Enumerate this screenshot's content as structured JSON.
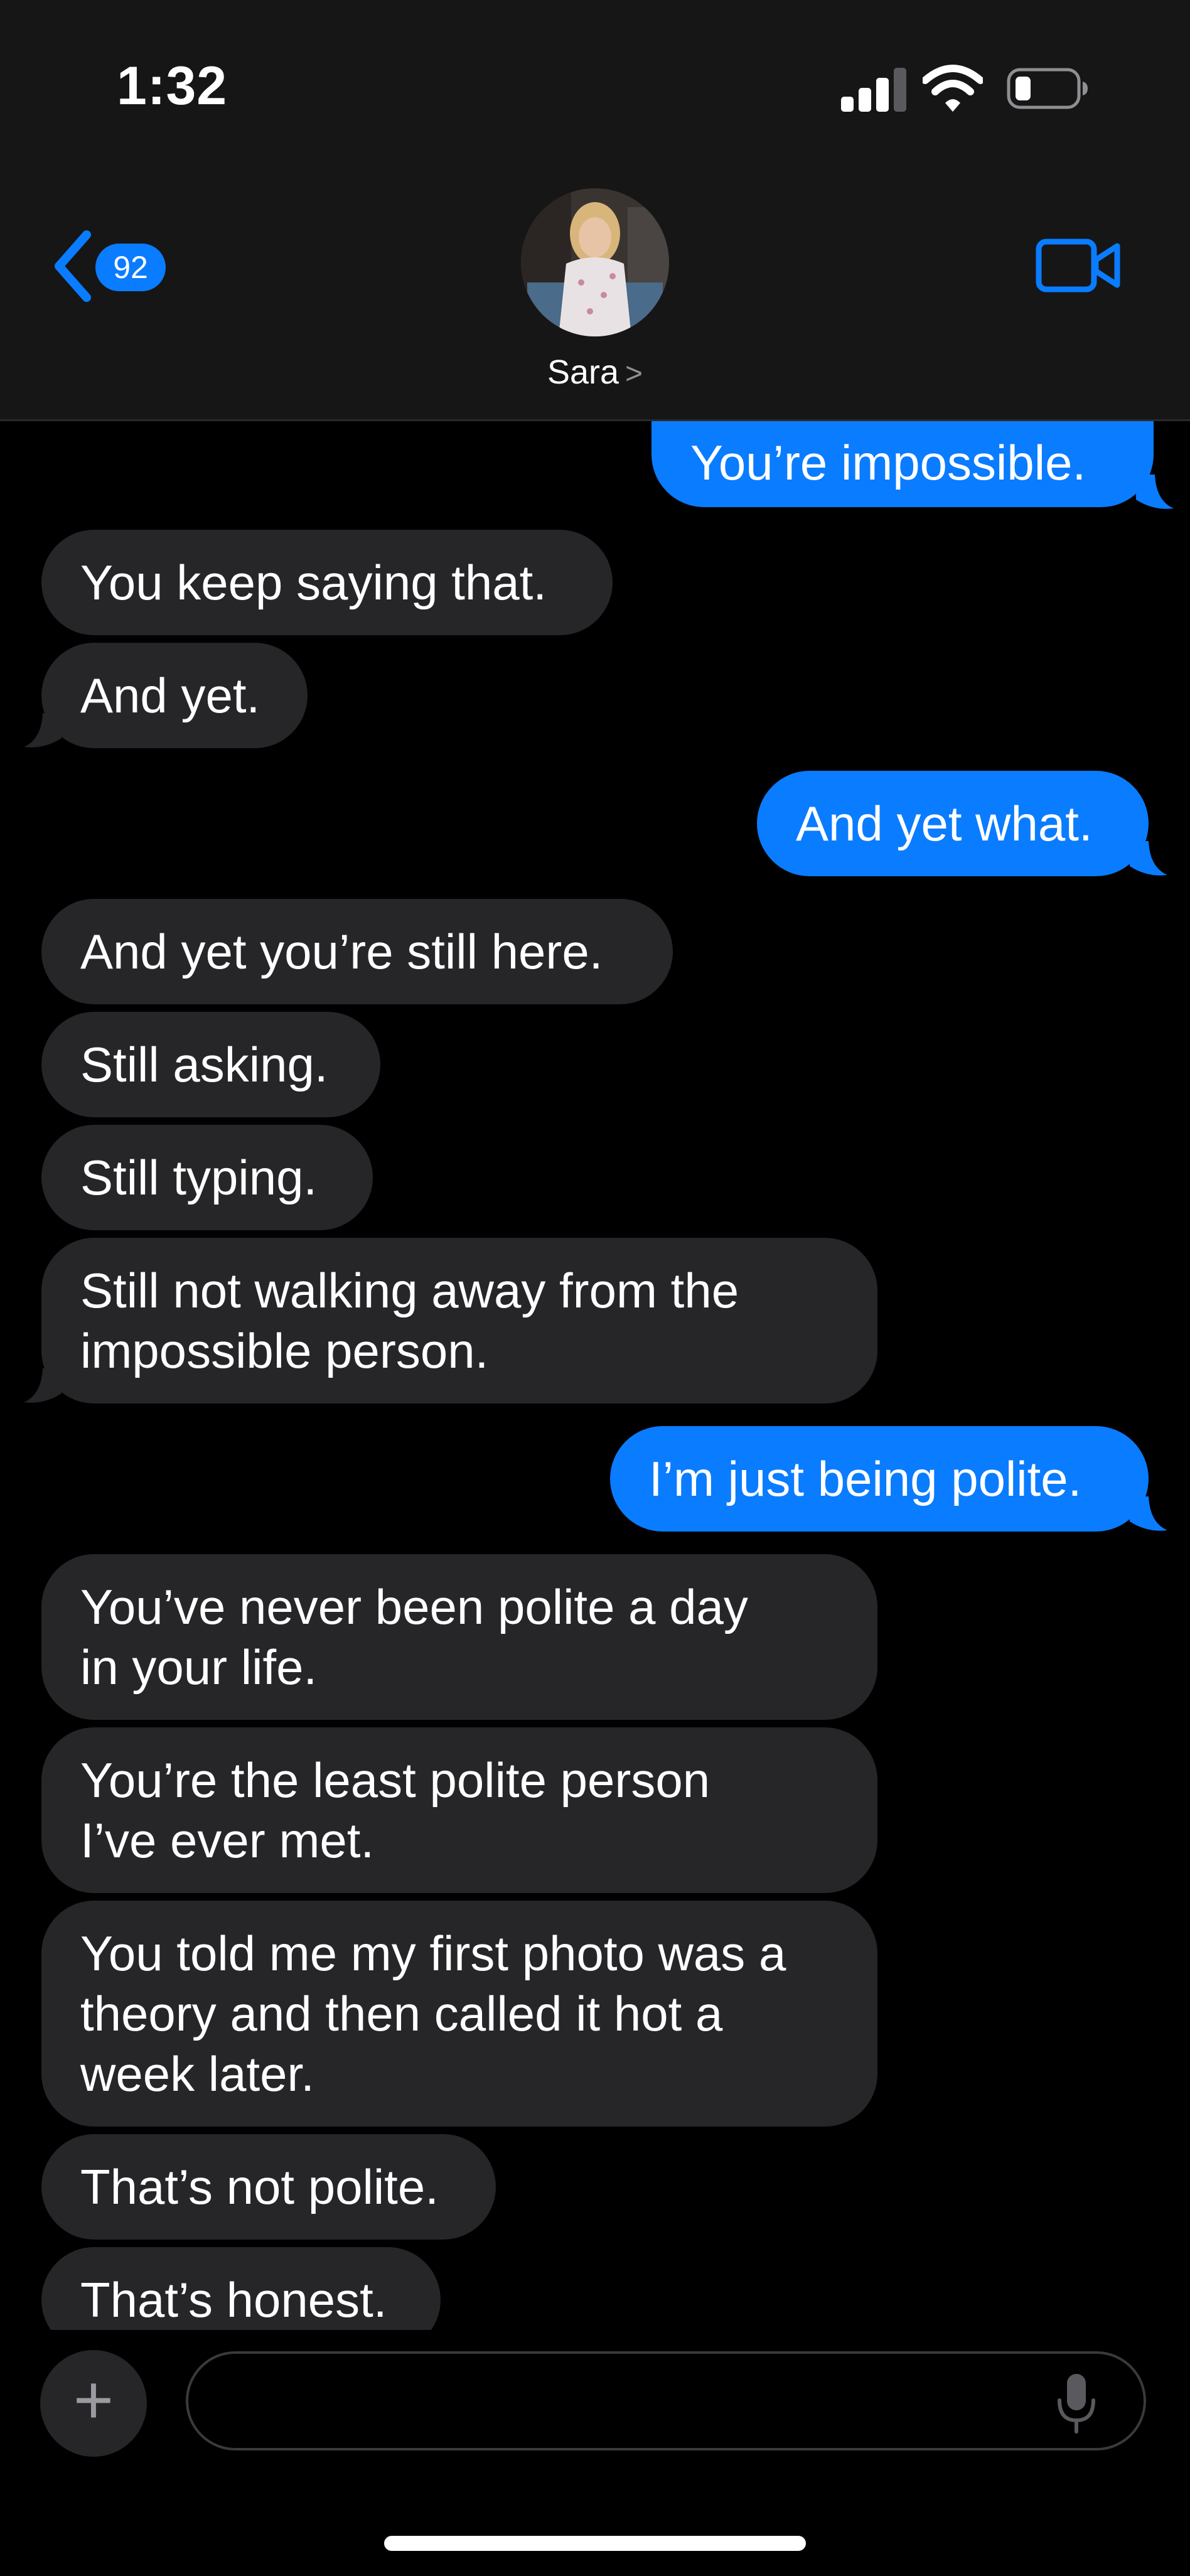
{
  "status_bar": {
    "time": "1:32"
  },
  "header": {
    "back_count": "92",
    "contact_name": "Sara",
    "name_chevron": ">"
  },
  "messages": [
    {
      "side": "sent",
      "text": "You’re impossible."
    },
    {
      "side": "received",
      "text": "You keep saying that."
    },
    {
      "side": "received",
      "text": "And yet."
    },
    {
      "side": "sent",
      "text": "And yet what."
    },
    {
      "side": "received",
      "text": "And yet you’re still here."
    },
    {
      "side": "received",
      "text": "Still asking."
    },
    {
      "side": "received",
      "text": "Still typing."
    },
    {
      "side": "received",
      "text": "Still not walking away from the\nimpossible person."
    },
    {
      "side": "sent",
      "text": "I’m just being polite."
    },
    {
      "side": "received",
      "text": "You’ve never been polite a day\nin your life."
    },
    {
      "side": "received",
      "text": "You’re the least polite person\nI’ve ever met."
    },
    {
      "side": "received",
      "text": "You told me my first photo was a\ntheory and then called it hot a\nweek later."
    },
    {
      "side": "received",
      "text": "That’s not polite."
    },
    {
      "side": "received",
      "text": "That’s honest."
    }
  ],
  "input_bar": {
    "plus_symbol": "+",
    "message_placeholder": ""
  },
  "colors": {
    "sent_bubble": "#0a7cff",
    "received_bubble": "#262629",
    "header_bg": "#161616",
    "accent": "#0a7cff"
  },
  "icons": [
    "back-chevron-icon",
    "video-camera-icon",
    "signal-icon",
    "wifi-icon",
    "battery-icon",
    "plus-icon",
    "microphone-icon"
  ]
}
